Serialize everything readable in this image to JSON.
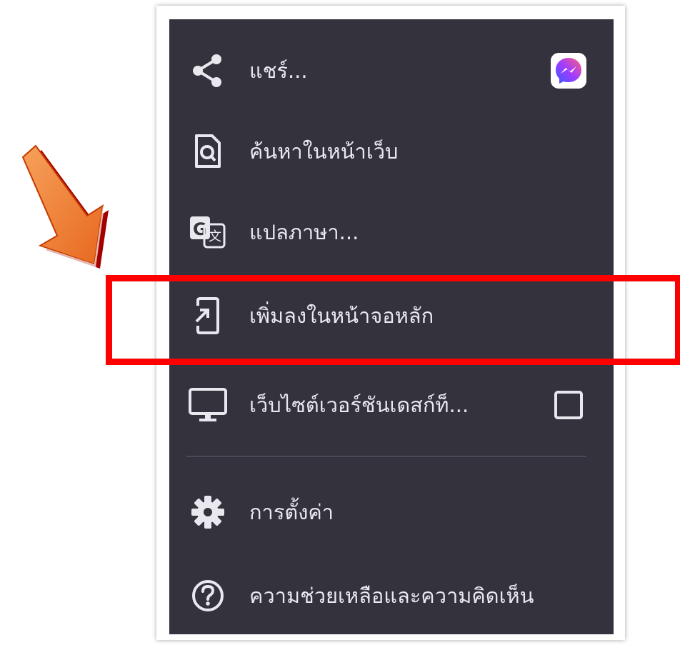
{
  "menu": {
    "items": [
      {
        "label": "แชร์...",
        "icon": "share-icon"
      },
      {
        "label": "ค้นหาในหน้าเว็บ",
        "icon": "find-in-page-icon"
      },
      {
        "label": "แปลภาษา...",
        "icon": "translate-icon"
      },
      {
        "label": "เพิ่มลงในหน้าจอหลัก",
        "icon": "add-to-home-screen-icon"
      },
      {
        "label": "เว็บไซต์เวอร์ชันเดสก์ท็...",
        "icon": "desktop-icon"
      },
      {
        "label": "การตั้งค่า",
        "icon": "settings-gear-icon"
      },
      {
        "label": "ความช่วยเหลือและความคิดเห็น",
        "icon": "help-icon"
      }
    ],
    "share_app_icon": "messenger-icon",
    "desktop_checkbox_checked": false
  },
  "colors": {
    "menu_background": "#33323d",
    "text": "#e8e8ee",
    "highlight": "#ff0000",
    "arrow": "#ef7a2e"
  }
}
